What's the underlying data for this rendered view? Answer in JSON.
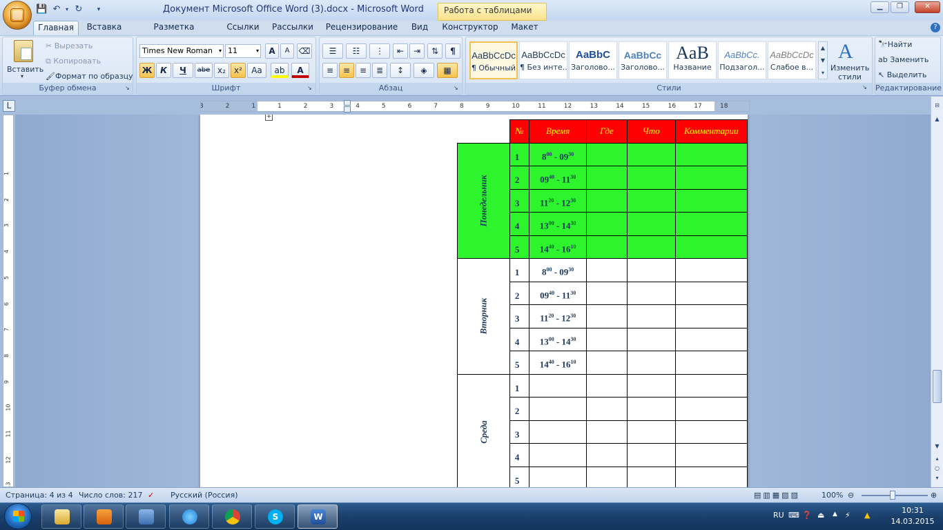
{
  "window": {
    "title": "Документ Microsoft Office Word (3).docx - Microsoft Word",
    "context_group": "Работа с таблицами"
  },
  "tabs": [
    "Главная",
    "Вставка",
    "Разметка страницы",
    "Ссылки",
    "Рассылки",
    "Рецензирование",
    "Вид",
    "Конструктор",
    "Макет"
  ],
  "clipboard": {
    "paste": "Вставить",
    "cut": "Вырезать",
    "copy": "Копировать",
    "format_painter": "Формат по образцу",
    "label": "Буфер обмена"
  },
  "font": {
    "name": "Times New Roman",
    "size": "11",
    "label": "Шрифт",
    "bold": "Ж",
    "italic": "К",
    "underline": "Ч",
    "strike": "abe",
    "sub": "x₂",
    "sup": "x²",
    "case": "Aa",
    "grow": "A",
    "shrink": "A"
  },
  "paragraph": {
    "label": "Абзац"
  },
  "styles": {
    "label": "Стили",
    "items": [
      {
        "preview": "AaBbCcDc",
        "name": "¶ Обычный"
      },
      {
        "preview": "AaBbCcDc",
        "name": "¶ Без инте..."
      },
      {
        "preview": "AaBbC",
        "name": "Заголово..."
      },
      {
        "preview": "AaBbCc",
        "name": "Заголово..."
      },
      {
        "preview": "AaB",
        "name": "Название"
      },
      {
        "preview": "AaBbCc.",
        "name": "Подзагол..."
      },
      {
        "preview": "AaBbCcDc",
        "name": "Слабое в..."
      }
    ],
    "change": "Изменить стили"
  },
  "editing": {
    "find": "Найти",
    "replace": "Заменить",
    "select": "Выделить",
    "label": "Редактирование"
  },
  "ruler": {
    "ticks": [
      "3",
      "2",
      "1",
      "1",
      "2",
      "3",
      "4",
      "5",
      "6",
      "7",
      "8",
      "9",
      "10",
      "11",
      "12",
      "13",
      "14",
      "15",
      "16",
      "17",
      "18"
    ]
  },
  "table": {
    "headers": [
      "№",
      "Время",
      "Где",
      "Что",
      "Комментарии"
    ],
    "days": [
      {
        "name": "Понедельник",
        "rows": [
          {
            "n": "1",
            "t1": "8",
            "s1": "00",
            "t2": "09",
            "s2": "30"
          },
          {
            "n": "2",
            "t1": "09",
            "s1": "40",
            "t2": "11",
            "s2": "30"
          },
          {
            "n": "3",
            "t1": "11",
            "s1": "20",
            "t2": "12",
            "s2": "30"
          },
          {
            "n": "4",
            "t1": "13",
            "s1": "00",
            "t2": "14",
            "s2": "30"
          },
          {
            "n": "5",
            "t1": "14",
            "s1": "40",
            "t2": "16",
            "s2": "10"
          }
        ]
      },
      {
        "name": "Вторник",
        "rows": [
          {
            "n": "1",
            "t1": "8",
            "s1": "00",
            "t2": "09",
            "s2": "30"
          },
          {
            "n": "2",
            "t1": "09",
            "s1": "40",
            "t2": "11",
            "s2": "30"
          },
          {
            "n": "3",
            "t1": "11",
            "s1": "20",
            "t2": "12",
            "s2": "30"
          },
          {
            "n": "4",
            "t1": "13",
            "s1": "00",
            "t2": "14",
            "s2": "30"
          },
          {
            "n": "5",
            "t1": "14",
            "s1": "40",
            "t2": "16",
            "s2": "10"
          }
        ]
      },
      {
        "name": "Среда",
        "rows": [
          {
            "n": "1"
          },
          {
            "n": "2"
          },
          {
            "n": "3"
          },
          {
            "n": "4"
          },
          {
            "n": "5"
          }
        ]
      }
    ]
  },
  "status": {
    "page": "Страница: 4 из 4",
    "words": "Число слов: 217",
    "lang": "Русский (Россия)",
    "zoom": "100%"
  },
  "tray": {
    "lang": "RU",
    "time": "10:31",
    "date": "14.03.2015"
  },
  "colors": {
    "header_bg": "#ff0000",
    "header_text": "#ffff00",
    "monday_bg": "#2ef42e"
  }
}
